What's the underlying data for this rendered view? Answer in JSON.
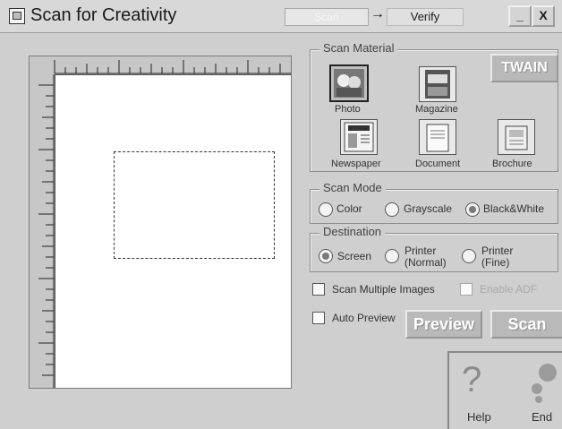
{
  "window": {
    "title": "Scan for Creativity",
    "minimize_label": "_",
    "close_label": "X",
    "steps": {
      "scan": "Scan",
      "arrow": "→",
      "verify": "Verify"
    }
  },
  "scan_material": {
    "legend": "Scan Material",
    "items": [
      {
        "label": "Photo",
        "icon": "photo-icon",
        "selected": true
      },
      {
        "label": "Magazine",
        "icon": "magazine-icon",
        "selected": false
      },
      {
        "label": "Newspaper",
        "icon": "newspaper-icon",
        "selected": false
      },
      {
        "label": "Document",
        "icon": "document-icon",
        "selected": false
      },
      {
        "label": "Brochure",
        "icon": "brochure-icon",
        "selected": false
      }
    ],
    "twain_label": "TWAIN"
  },
  "scan_mode": {
    "legend": "Scan Mode",
    "options": [
      {
        "label": "Color",
        "selected": false
      },
      {
        "label": "Grayscale",
        "selected": false
      },
      {
        "label": "Black&White",
        "selected": true
      }
    ]
  },
  "destination": {
    "legend": "Destination",
    "options": [
      {
        "label": "Screen",
        "selected": true
      },
      {
        "label": "Printer\n(Normal)",
        "selected": false
      },
      {
        "label": "Printer\n(Fine)",
        "selected": false
      }
    ]
  },
  "options": {
    "scan_multiple": "Scan Multiple Images",
    "enable_adf": "Enable ADF",
    "auto_preview": "Auto Preview"
  },
  "buttons": {
    "preview": "Preview",
    "scan": "Scan",
    "help": "Help",
    "end": "End"
  },
  "colors": {
    "background": "#cfcfcf",
    "accent": "#b9b9b9"
  }
}
